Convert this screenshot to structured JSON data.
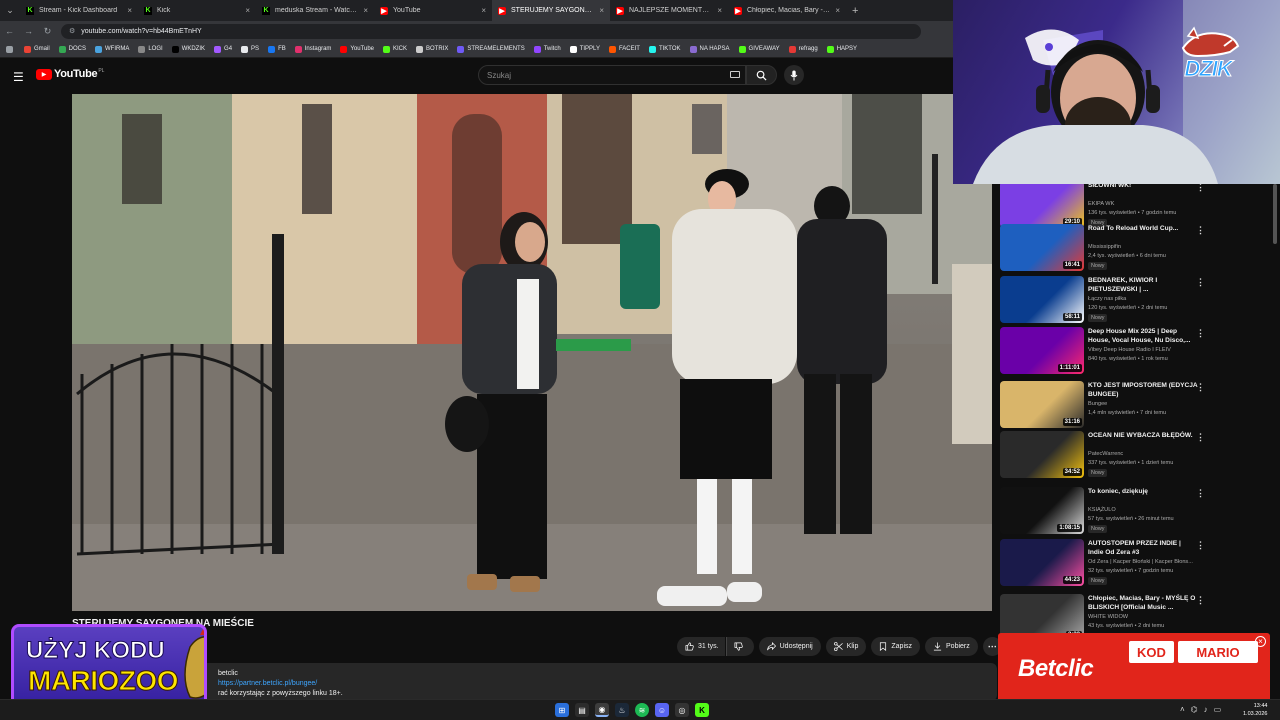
{
  "browser": {
    "tabs": [
      {
        "label": "Stream - Kick Dashboard",
        "icon": "kick-icon",
        "active": false
      },
      {
        "label": "Kick",
        "icon": "kick-icon",
        "active": false
      },
      {
        "label": "meduska Stream - Watch Live o",
        "icon": "kick-icon",
        "active": false
      },
      {
        "label": "YouTube",
        "icon": "youtube-icon",
        "active": false
      },
      {
        "label": "STERUJEMY SAYGONEM NA",
        "icon": "youtube-icon",
        "active": true
      },
      {
        "label": "NAJLEPSZE MOMENTY POLSKI",
        "icon": "youtube-icon",
        "active": false
      },
      {
        "label": "Chłopiec, Macias, Bary - MYŚLĘ",
        "icon": "youtube-icon",
        "active": false
      }
    ],
    "url": "youtube.com/watch?v=hb44BmETnHY",
    "bookmarks": [
      {
        "label": "Gmail",
        "color": "#ea4335"
      },
      {
        "label": "DOCS",
        "color": "#34a853"
      },
      {
        "label": "WFIRMA",
        "color": "#4aa3df"
      },
      {
        "label": "LOGI",
        "color": "#888888"
      },
      {
        "label": "WKDZIK",
        "color": "#000000"
      },
      {
        "label": "G4",
        "color": "#a259ff"
      },
      {
        "label": "PS",
        "color": "#e8eaed"
      },
      {
        "label": "FB",
        "color": "#1877f2"
      },
      {
        "label": "Instagram",
        "color": "#e1306c"
      },
      {
        "label": "YouTube",
        "color": "#ff0000"
      },
      {
        "label": "KICK",
        "color": "#53fc18"
      },
      {
        "label": "BOTRIX",
        "color": "#cccccc"
      },
      {
        "label": "STREAMELEMENTS",
        "color": "#6f5af6"
      },
      {
        "label": "Twitch",
        "color": "#9146ff"
      },
      {
        "label": "TIPPLY",
        "color": "#ffffff"
      },
      {
        "label": "FACEIT",
        "color": "#ff5500"
      },
      {
        "label": "TIKTOK",
        "color": "#25f4ee"
      },
      {
        "label": "NA HAPSA",
        "color": "#8a6bd1"
      },
      {
        "label": "GIVEAWAY",
        "color": "#53fc18"
      },
      {
        "label": "refragg",
        "color": "#e53935"
      },
      {
        "label": "HAPSY",
        "color": "#53fc18"
      }
    ]
  },
  "youtube": {
    "logo": "YouTube",
    "region": "PL",
    "search_placeholder": "Szukaj",
    "video": {
      "title": "STERUJEMY SAYGONEM NA MIEŚCIE",
      "likes": "31 tys.",
      "share": "Udostępnij",
      "clip": "Klip",
      "save": "Zapisz",
      "download": "Pobierz",
      "description_line1_prefix": "betclic",
      "description_link": "https://partner.betclic.pl/bungee/",
      "description_line2": "rać korzystając z powyższego linku 18+."
    },
    "recommendations": [
      {
        "title": "SIŁOWNI WK!",
        "channel": "EKIPA WK",
        "views": "136 tys. wyświetleń",
        "age": "7 godzin temu",
        "badge": "Nowy",
        "duration": "29:10"
      },
      {
        "title": "Road To Reload World Cup...",
        "channel": "Mississippifin",
        "views": "2,4 tys. wyświetleń",
        "age": "6 dni temu",
        "badge": "Nowy",
        "duration": "16:41"
      },
      {
        "title": "BEDNAREK, KIWIOR I PIETUSZEWSKI | ...",
        "channel": "Łączy nas piłka",
        "views": "120 tys. wyświetleń",
        "age": "2 dni temu",
        "badge": "Nowy",
        "duration": "58:11"
      },
      {
        "title": "Deep House Mix 2025 | Deep House, Vocal House, Nu Disco,...",
        "channel": "Vibey Deep House Radio I FLEIV",
        "views": "840 tys. wyświetleń",
        "age": "1 rok temu",
        "badge": "",
        "duration": "1:11:01"
      },
      {
        "title": "KTO JEST IMPOSTOREM (EDYCJA BUNGEE)",
        "channel": "Bungee",
        "views": "1,4 mln wyświetleń",
        "age": "7 dni temu",
        "badge": "",
        "duration": "31:16"
      },
      {
        "title": "OCEAN NIE WYBACZA BŁĘDÓW.",
        "channel": "PatecWarrenc",
        "views": "337 tys. wyświetleń",
        "age": "1 dzień temu",
        "badge": "Nowy",
        "duration": "34:52"
      },
      {
        "title": "To koniec, dziękuję",
        "channel": "KSIĄŻULO",
        "views": "57 tys. wyświetleń",
        "age": "26 minut temu",
        "badge": "Nowy",
        "duration": "1:08:15"
      },
      {
        "title": "AUTOSTOPEM PRZEZ INDIE | Indie Od Zera #3",
        "channel": "Od Zera | Kacper Błoński | Kacper Błons...",
        "views": "32 tys. wyświetleń",
        "age": "7 godzin temu",
        "badge": "Nowy",
        "duration": "44:23"
      },
      {
        "title": "Chłopiec, Macias, Bary - MYŚLĘ O BLISKICH [Official Music ...",
        "channel": "WHITE WIDOW",
        "views": "43 tys. wyświetleń",
        "age": "2 dni temu",
        "badge": "",
        "duration": "3:33"
      }
    ]
  },
  "overlays": {
    "stream_logo": "DZIK",
    "promo_line1": "UŻYJ KODU",
    "promo_line2": "MARIOZOO",
    "betclic_brand": "Betclic",
    "betclic_kod": "KOD",
    "betclic_code": "MARIO"
  },
  "taskbar": {
    "time": "13:44",
    "date": "1.03.2026"
  }
}
